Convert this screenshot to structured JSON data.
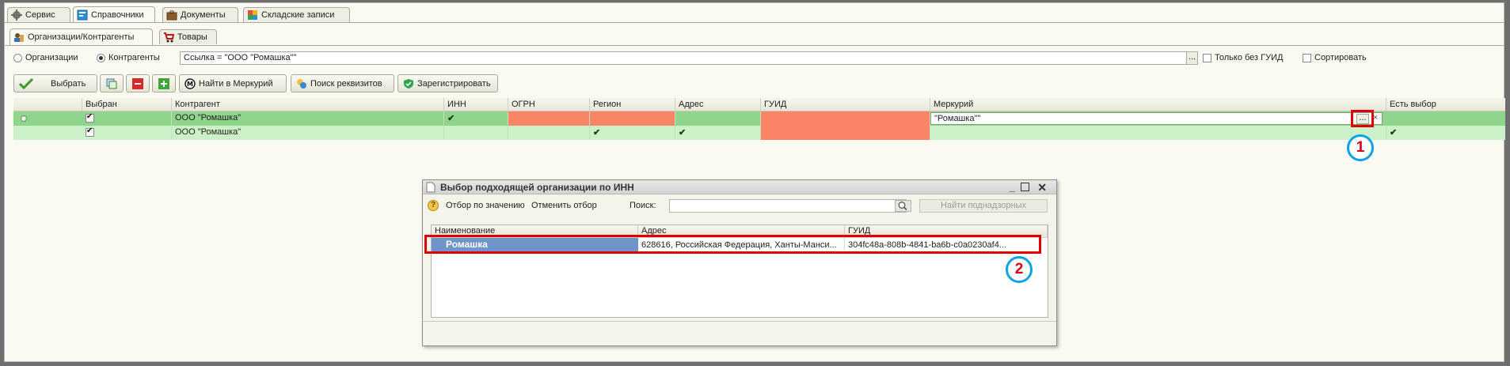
{
  "tabs_main": [
    {
      "label": "Сервис",
      "icon": "gear-icon"
    },
    {
      "label": "Справочники",
      "icon": "reference-book-icon"
    },
    {
      "label": "Документы",
      "icon": "briefcase-icon"
    },
    {
      "label": "Складские записи",
      "icon": "warehouse-records-icon"
    }
  ],
  "tabs_sub": [
    {
      "label": "Организации/Контрагенты",
      "icon": "organizations-icon"
    },
    {
      "label": "Товары",
      "icon": "cart-icon"
    }
  ],
  "filter": {
    "radio_org": "Организации",
    "radio_contr": "Контрагенты",
    "selected": "Контрагенты",
    "field_value": "Ссылка = \"ООО \"Ромашка\"\"",
    "ellipsis": "...",
    "chk_no_guid": "Только без ГУИД",
    "chk_sort": "Сортировать"
  },
  "toolbar": {
    "select": "Выбрать",
    "find_mercury": "Найти в Меркурий",
    "search_requisites": "Поиск реквизитов",
    "register": "Зарегистрировать"
  },
  "grid": {
    "columns": [
      "Выбран",
      "Контрагент",
      "ИНН",
      "ОГРН",
      "Регион",
      "Адрес",
      "ГУИД",
      "Меркурий",
      "Есть выбор"
    ],
    "rows": [
      {
        "selected": true,
        "name": "ООО \"Ромашка\"",
        "inn_ok": true,
        "region_ok": false,
        "address_ok": false,
        "mercury": "\"Ромашка\"\"",
        "has_choice": false
      },
      {
        "selected": true,
        "name": "ООО \"Ромашка\"",
        "inn_ok": false,
        "region_ok": true,
        "address_ok": true,
        "mercury": "",
        "has_choice": true
      }
    ],
    "cell_button": "...",
    "cell_clear": "×"
  },
  "annotations": [
    "1",
    "2"
  ],
  "dialog": {
    "title": "Выбор подходящей организации по ИНН",
    "filter_by_value": "Отбор по значению",
    "cancel_filter": "Отменить отбор",
    "search_label": "Поиск:",
    "search_value": "",
    "find_supervised": "Найти поднадзорных",
    "columns": [
      "Наименование",
      "Адрес",
      "ГУИД"
    ],
    "rows": [
      {
        "name": "Ромашка",
        "address": "628616, Российская Федерация, Ханты-Манси...",
        "guid": "304fc48a-808b-4841-ba6b-c0a0230af4..."
      }
    ]
  },
  "colors": {
    "row_selected": "#8fd58b",
    "row_normal": "#ccf0c7",
    "cell_warning": "#fa8466",
    "dialog_row_selected": "#6e94c9",
    "annotation_red": "#e00000",
    "annotation_blue": "#0aa2e8"
  }
}
